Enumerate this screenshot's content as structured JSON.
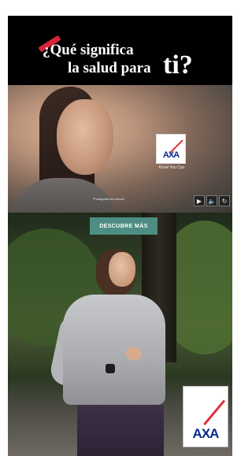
{
  "headline": {
    "line1": "¿Qué significa",
    "line2": "la salud para",
    "emphasis": "ti?"
  },
  "video": {
    "brand_logo_text": "AXA",
    "tagline": "Know You Can",
    "caption": "*Protagonista del anuncio",
    "controls": {
      "play_icon": "▶",
      "volume_icon": "🔈",
      "replay_icon": "↻"
    }
  },
  "cta": {
    "label": "DESCUBRE MÁS"
  },
  "footer_logo_text": "AXA",
  "colors": {
    "brand_red": "#d6243a",
    "brand_blue": "#0a2a8a",
    "cta_teal": "#4e8d83",
    "header_black": "#000000"
  }
}
